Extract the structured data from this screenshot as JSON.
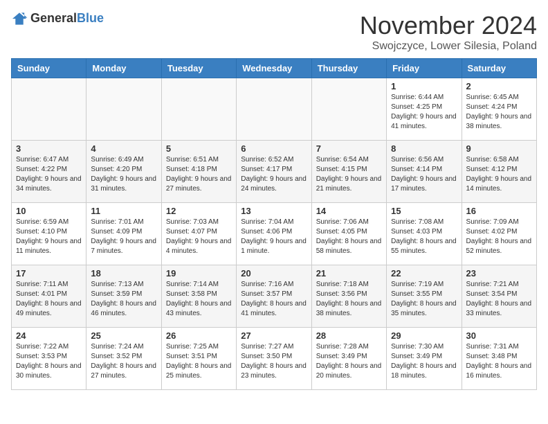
{
  "header": {
    "logo_general": "General",
    "logo_blue": "Blue",
    "month_title": "November 2024",
    "location": "Swojczyce, Lower Silesia, Poland"
  },
  "columns": [
    "Sunday",
    "Monday",
    "Tuesday",
    "Wednesday",
    "Thursday",
    "Friday",
    "Saturday"
  ],
  "weeks": [
    [
      {
        "day": "",
        "info": ""
      },
      {
        "day": "",
        "info": ""
      },
      {
        "day": "",
        "info": ""
      },
      {
        "day": "",
        "info": ""
      },
      {
        "day": "",
        "info": ""
      },
      {
        "day": "1",
        "info": "Sunrise: 6:44 AM\nSunset: 4:25 PM\nDaylight: 9 hours and 41 minutes."
      },
      {
        "day": "2",
        "info": "Sunrise: 6:45 AM\nSunset: 4:24 PM\nDaylight: 9 hours and 38 minutes."
      }
    ],
    [
      {
        "day": "3",
        "info": "Sunrise: 6:47 AM\nSunset: 4:22 PM\nDaylight: 9 hours and 34 minutes."
      },
      {
        "day": "4",
        "info": "Sunrise: 6:49 AM\nSunset: 4:20 PM\nDaylight: 9 hours and 31 minutes."
      },
      {
        "day": "5",
        "info": "Sunrise: 6:51 AM\nSunset: 4:18 PM\nDaylight: 9 hours and 27 minutes."
      },
      {
        "day": "6",
        "info": "Sunrise: 6:52 AM\nSunset: 4:17 PM\nDaylight: 9 hours and 24 minutes."
      },
      {
        "day": "7",
        "info": "Sunrise: 6:54 AM\nSunset: 4:15 PM\nDaylight: 9 hours and 21 minutes."
      },
      {
        "day": "8",
        "info": "Sunrise: 6:56 AM\nSunset: 4:14 PM\nDaylight: 9 hours and 17 minutes."
      },
      {
        "day": "9",
        "info": "Sunrise: 6:58 AM\nSunset: 4:12 PM\nDaylight: 9 hours and 14 minutes."
      }
    ],
    [
      {
        "day": "10",
        "info": "Sunrise: 6:59 AM\nSunset: 4:10 PM\nDaylight: 9 hours and 11 minutes."
      },
      {
        "day": "11",
        "info": "Sunrise: 7:01 AM\nSunset: 4:09 PM\nDaylight: 9 hours and 7 minutes."
      },
      {
        "day": "12",
        "info": "Sunrise: 7:03 AM\nSunset: 4:07 PM\nDaylight: 9 hours and 4 minutes."
      },
      {
        "day": "13",
        "info": "Sunrise: 7:04 AM\nSunset: 4:06 PM\nDaylight: 9 hours and 1 minute."
      },
      {
        "day": "14",
        "info": "Sunrise: 7:06 AM\nSunset: 4:05 PM\nDaylight: 8 hours and 58 minutes."
      },
      {
        "day": "15",
        "info": "Sunrise: 7:08 AM\nSunset: 4:03 PM\nDaylight: 8 hours and 55 minutes."
      },
      {
        "day": "16",
        "info": "Sunrise: 7:09 AM\nSunset: 4:02 PM\nDaylight: 8 hours and 52 minutes."
      }
    ],
    [
      {
        "day": "17",
        "info": "Sunrise: 7:11 AM\nSunset: 4:01 PM\nDaylight: 8 hours and 49 minutes."
      },
      {
        "day": "18",
        "info": "Sunrise: 7:13 AM\nSunset: 3:59 PM\nDaylight: 8 hours and 46 minutes."
      },
      {
        "day": "19",
        "info": "Sunrise: 7:14 AM\nSunset: 3:58 PM\nDaylight: 8 hours and 43 minutes."
      },
      {
        "day": "20",
        "info": "Sunrise: 7:16 AM\nSunset: 3:57 PM\nDaylight: 8 hours and 41 minutes."
      },
      {
        "day": "21",
        "info": "Sunrise: 7:18 AM\nSunset: 3:56 PM\nDaylight: 8 hours and 38 minutes."
      },
      {
        "day": "22",
        "info": "Sunrise: 7:19 AM\nSunset: 3:55 PM\nDaylight: 8 hours and 35 minutes."
      },
      {
        "day": "23",
        "info": "Sunrise: 7:21 AM\nSunset: 3:54 PM\nDaylight: 8 hours and 33 minutes."
      }
    ],
    [
      {
        "day": "24",
        "info": "Sunrise: 7:22 AM\nSunset: 3:53 PM\nDaylight: 8 hours and 30 minutes."
      },
      {
        "day": "25",
        "info": "Sunrise: 7:24 AM\nSunset: 3:52 PM\nDaylight: 8 hours and 27 minutes."
      },
      {
        "day": "26",
        "info": "Sunrise: 7:25 AM\nSunset: 3:51 PM\nDaylight: 8 hours and 25 minutes."
      },
      {
        "day": "27",
        "info": "Sunrise: 7:27 AM\nSunset: 3:50 PM\nDaylight: 8 hours and 23 minutes."
      },
      {
        "day": "28",
        "info": "Sunrise: 7:28 AM\nSunset: 3:49 PM\nDaylight: 8 hours and 20 minutes."
      },
      {
        "day": "29",
        "info": "Sunrise: 7:30 AM\nSunset: 3:49 PM\nDaylight: 8 hours and 18 minutes."
      },
      {
        "day": "30",
        "info": "Sunrise: 7:31 AM\nSunset: 3:48 PM\nDaylight: 8 hours and 16 minutes."
      }
    ]
  ]
}
